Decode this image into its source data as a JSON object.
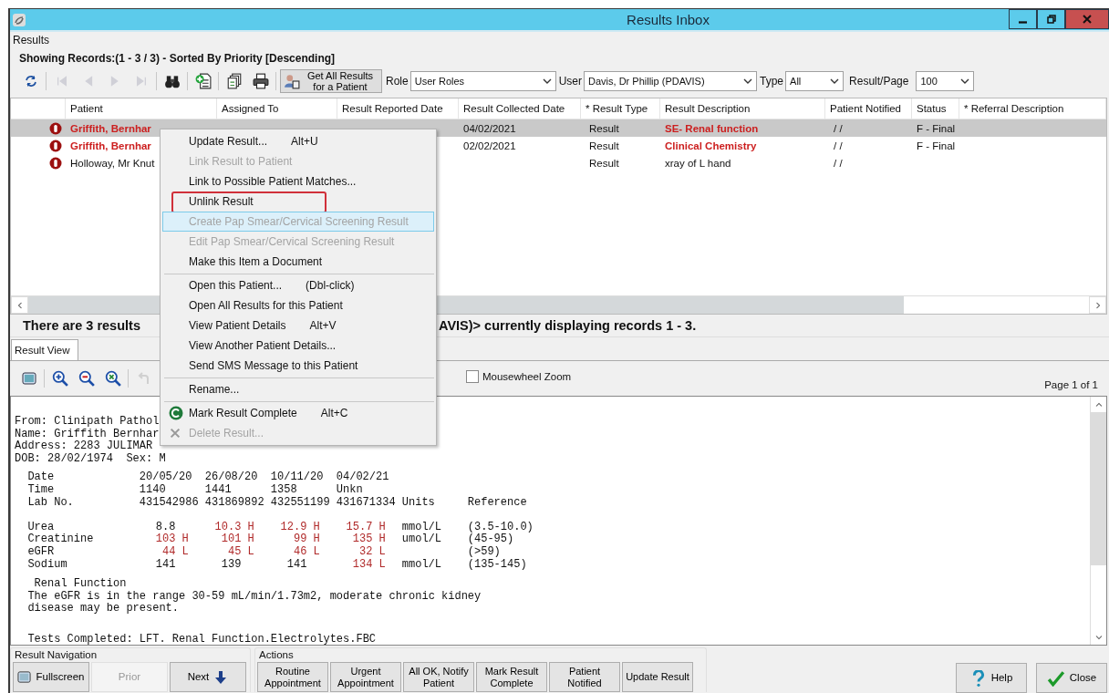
{
  "window": {
    "title": "Results Inbox"
  },
  "panel_label": "Results",
  "summary": "Showing Records:(1 - 3 / 3) - Sorted By Priority [Descending]",
  "toolbar": {
    "tools": [
      {
        "kind": "refresh",
        "disabled": false
      },
      {
        "kind": "separator"
      },
      {
        "kind": "first",
        "disabled": true
      },
      {
        "kind": "prev",
        "disabled": true
      },
      {
        "kind": "next",
        "disabled": true
      },
      {
        "kind": "last",
        "disabled": true
      },
      {
        "kind": "separator"
      },
      {
        "kind": "search",
        "disabled": false
      },
      {
        "kind": "separator"
      },
      {
        "kind": "add",
        "disabled": false
      },
      {
        "kind": "separator"
      },
      {
        "kind": "copy",
        "disabled": false
      },
      {
        "kind": "print",
        "disabled": false
      },
      {
        "kind": "separator"
      }
    ],
    "get_all_button": "Get All Results for a Patient",
    "filters": [
      {
        "label": "Role",
        "value": "User Roles"
      },
      {
        "label": "User",
        "value": "Davis, Dr Phillip (PDAVIS)"
      },
      {
        "label": "Type",
        "value": "All"
      },
      {
        "label": "Result/Page",
        "value": "100"
      }
    ]
  },
  "table": {
    "columns": [
      "Patient",
      "Assigned To",
      "Result Reported Date",
      "Result Collected Date",
      "* Result Type",
      "Result Description",
      "Patient Notified",
      "Status",
      "* Referral Description"
    ],
    "rows": [
      {
        "patient": "Griffith, Bernhar",
        "collected": "04/02/2021",
        "type": "Result",
        "description": "SE- Renal function",
        "notified": "/ /",
        "status": "F - Final",
        "abnormal": true,
        "selected": true
      },
      {
        "patient": "Griffith, Bernhar",
        "collected": "02/02/2021",
        "type": "Result",
        "description": "Clinical Chemistry",
        "notified": "/ /",
        "status": "F - Final",
        "abnormal": true,
        "selected": false
      },
      {
        "patient": "Holloway, Mr Knut",
        "type": "Result",
        "description": "xray of L hand",
        "notified": "/ /",
        "abnormal": false,
        "selected": false
      }
    ]
  },
  "status_text": {
    "left": "There are 3 results",
    "right": "AVIS)> currently displaying records 1 - 3."
  },
  "result_view": {
    "tab": {
      "label": "Result View",
      "selected": true
    },
    "tools": [
      {
        "kind": "screen",
        "disabled": false
      },
      {
        "kind": "separator"
      },
      {
        "kind": "zoom-in",
        "disabled": false
      },
      {
        "kind": "zoom-out",
        "disabled": false
      },
      {
        "kind": "zoom-fit",
        "disabled": false
      },
      {
        "kind": "separator"
      },
      {
        "kind": "undo",
        "disabled": true
      }
    ],
    "mousewheel_zoom": {
      "label": "Mousewheel Zoom",
      "checked": false
    },
    "page": "Page 1 of 1",
    "document": {
      "header_lines": [
        "From: Clinipath Pathol",
        "Name: Griffith Bernhar",
        "Address: 2283 JULIMAR",
        "DOB: 28/02/1974  Sex: M"
      ],
      "lab_header": [
        {
          "label": "Date",
          "values": [
            "20/05/20",
            "26/08/20",
            "10/11/20",
            "04/02/21"
          ]
        },
        {
          "label": "Time",
          "values": [
            "1140",
            "1441",
            "1358",
            "Unkn"
          ]
        },
        {
          "label": "Lab No.",
          "values": [
            "431542986",
            "431869892",
            "432551199",
            "431671334"
          ],
          "units": "Units",
          "reference": "Reference"
        }
      ],
      "lab_rows": [
        {
          "label": "Urea",
          "values": [
            {
              "text": "8.8",
              "abnormal": false
            },
            {
              "text": "10.3 H",
              "abnormal": true
            },
            {
              "text": "12.9 H",
              "abnormal": true
            },
            {
              "text": "15.7 H",
              "abnormal": true
            }
          ],
          "units": "mmol/L",
          "reference": "(3.5-10.0)"
        },
        {
          "label": "Creatinine",
          "values": [
            {
              "text": "103 H",
              "abnormal": true
            },
            {
              "text": "101 H",
              "abnormal": true
            },
            {
              "text": "99 H",
              "abnormal": true
            },
            {
              "text": "135 H",
              "abnormal": true
            }
          ],
          "units": "umol/L",
          "reference": "(45-95)"
        },
        {
          "label": "eGFR",
          "values": [
            {
              "text": "44 L",
              "abnormal": true
            },
            {
              "text": "45 L",
              "abnormal": true
            },
            {
              "text": "46 L",
              "abnormal": true
            },
            {
              "text": "32 L",
              "abnormal": true
            }
          ],
          "reference": "(>59)"
        },
        {
          "label": "Sodium",
          "values": [
            {
              "text": "141",
              "abnormal": false
            },
            {
              "text": "139",
              "abnormal": false
            },
            {
              "text": "141",
              "abnormal": false
            },
            {
              "text": "134 L",
              "abnormal": true
            }
          ],
          "units": "mmol/L",
          "reference": "(135-145)"
        }
      ],
      "comment_title": "Renal Function",
      "comment": "The eGFR is in the range 30-59 mL/min/1.73m2, moderate chronic kidney disease may be present.",
      "footer": "Tests Completed: LFT. Renal Function.Electrolytes.FBC"
    }
  },
  "navigation": {
    "title": "Result Navigation",
    "buttons": [
      {
        "label": "Fullscreen",
        "kind": "fullscreen",
        "disabled": false
      },
      {
        "label": "Prior",
        "kind": "plain",
        "disabled": true
      },
      {
        "label": "Next",
        "kind": "next",
        "disabled": false
      }
    ]
  },
  "actions": {
    "title": "Actions",
    "buttons": [
      "Routine Appointment",
      "Urgent Appointment",
      "All OK, Notify Patient",
      "Mark Result Complete",
      "Patient Notified",
      "Update Result"
    ]
  },
  "dialog_buttons": [
    {
      "label": "Help",
      "kind": "help"
    },
    {
      "label": "Close",
      "kind": "close"
    }
  ],
  "context_menu": {
    "items": [
      {
        "kind": "item",
        "label": "Update Result...",
        "shortcut": "Alt+U",
        "disabled": false,
        "hovered": false,
        "outlined": false
      },
      {
        "kind": "item",
        "label": "Link Result to Patient",
        "disabled": true,
        "hovered": false,
        "outlined": false
      },
      {
        "kind": "item",
        "label": "Link to Possible Patient Matches...",
        "disabled": false,
        "hovered": false,
        "outlined": false
      },
      {
        "kind": "item",
        "label": "Unlink Result",
        "disabled": false,
        "hovered": false,
        "outlined": true
      },
      {
        "kind": "item",
        "label": "Create Pap Smear/Cervical Screening Result",
        "disabled": true,
        "hovered": true,
        "outlined": false
      },
      {
        "kind": "item",
        "label": "Edit Pap Smear/Cervical Screening Result",
        "disabled": true,
        "hovered": false,
        "outlined": false
      },
      {
        "kind": "item",
        "label": "Make this Item a Document",
        "disabled": false,
        "hovered": false,
        "outlined": false
      },
      {
        "kind": "separator"
      },
      {
        "kind": "item",
        "label": "Open this Patient...",
        "shortcut": "(Dbl-click)",
        "disabled": false,
        "hovered": false,
        "outlined": false
      },
      {
        "kind": "item",
        "label": "Open All Results for this Patient",
        "disabled": false,
        "hovered": false,
        "outlined": false
      },
      {
        "kind": "item",
        "label": "View Patient Details",
        "shortcut": "Alt+V",
        "disabled": false,
        "hovered": false,
        "outlined": false
      },
      {
        "kind": "item",
        "label": "View Another Patient Details...",
        "disabled": false,
        "hovered": false,
        "outlined": false
      },
      {
        "kind": "item",
        "label": "Send SMS Message to this Patient",
        "disabled": false,
        "hovered": false,
        "outlined": false
      },
      {
        "kind": "separator"
      },
      {
        "kind": "item",
        "label": "Rename...",
        "disabled": false,
        "hovered": false,
        "outlined": false
      },
      {
        "kind": "separator"
      },
      {
        "kind": "complete-item",
        "label": "Mark Result Complete",
        "shortcut": "Alt+C",
        "disabled": false,
        "hovered": false,
        "outlined": false
      },
      {
        "kind": "delete-item",
        "label": "Delete Result...",
        "disabled": true,
        "hovered": false,
        "outlined": false
      }
    ]
  }
}
